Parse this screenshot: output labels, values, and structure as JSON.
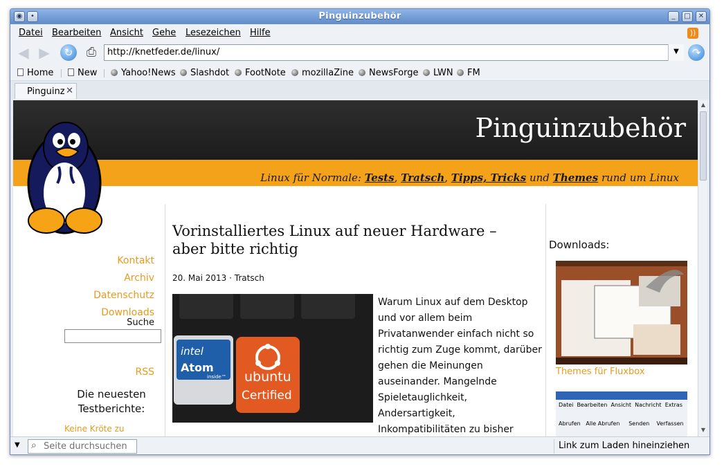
{
  "window": {
    "title": "Pinguinzubehör"
  },
  "menu": [
    "Datei",
    "Bearbeiten",
    "Ansicht",
    "Gehe",
    "Lesezeichen",
    "Hilfe"
  ],
  "navigation": {
    "url": "http://knetfeder.de/linux/"
  },
  "bookmarks": [
    "Home",
    "New",
    "Yahoo!News",
    "Slashdot",
    "FootNote",
    "mozillaZine",
    "NewsForge",
    "LWN",
    "FM"
  ],
  "tabs": [
    {
      "label": "Pinguinz"
    }
  ],
  "site": {
    "title": "Pinguinzubehör",
    "tagline_prefix": "Linux für Normale:",
    "tagline_links": [
      "Tests",
      "Tratsch",
      "Tipps, Tricks",
      "Themes"
    ],
    "tagline_joiners": [
      ",",
      ",",
      "und"
    ],
    "tagline_suffix": "rund um Linux"
  },
  "sidebar_left": {
    "links": [
      "Kontakt",
      "Archiv",
      "Datenschutz",
      "Downloads"
    ],
    "search_label": "Suche",
    "rss": "RSS",
    "newest_heading": "Die neuesten Testberichte:",
    "newest_link": "Keine Kröte zu"
  },
  "article": {
    "title": "Vorinstalliertes Linux auf neuer Hardware – aber bitte richtig",
    "date": "20. Mai 2013",
    "separator": "·",
    "category": "Tratsch",
    "text": "Warum Linux auf dem Desktop und vor allem beim Privatanwender einfach nicht so richtig zum Zuge kommt, darüber gehen die Meinungen auseinander. Mangelnde Spieletauglichkeit, Andersartigkeit, Inkompatibilitäten zu bisher",
    "image_text": {
      "brand1": "intel",
      "brand1_sub": "Atom",
      "brand1_small": "inside™",
      "brand2": "ubuntu",
      "brand2_sub": "Certified"
    }
  },
  "sidebar_right": {
    "heading": "Downloads:",
    "item1_caption": "Themes für Fluxbox",
    "item2_menu": [
      "Datei",
      "Bearbeiten",
      "Ansicht",
      "Nachricht",
      "Extras"
    ],
    "item2_toolbar": [
      "Abrufen",
      "Alle Abrufen",
      "Senden",
      "Verfassen"
    ]
  },
  "statusbar": {
    "find_placeholder": "Seite durchsuchen",
    "status": "Link zum Laden hineinziehen"
  },
  "colors": {
    "accent": "#e79a1c",
    "orange_bar": "#f4a21a",
    "header_dark": "#262626"
  }
}
